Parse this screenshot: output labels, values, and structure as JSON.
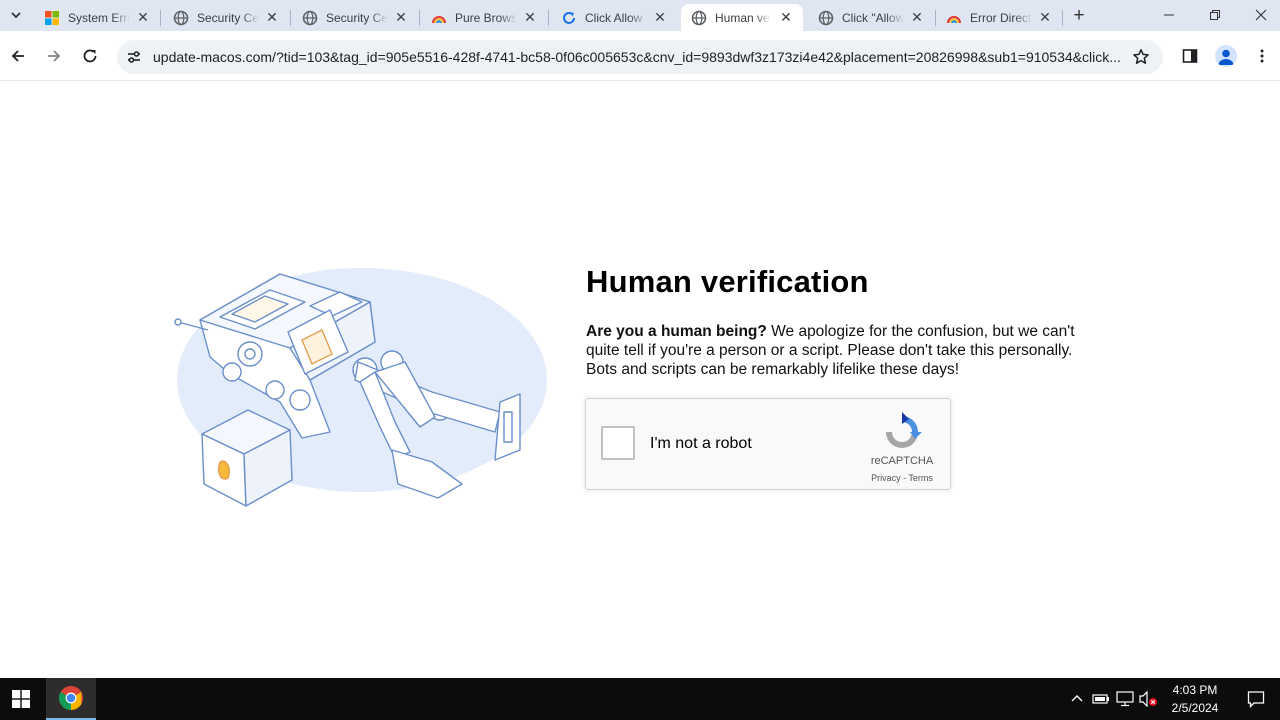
{
  "browser": {
    "tabs": [
      {
        "title": "System Error",
        "icon": "microsoft-icon",
        "active": false
      },
      {
        "title": "Security Center",
        "icon": "globe-icon",
        "active": false
      },
      {
        "title": "Security Center",
        "icon": "globe-icon",
        "active": false
      },
      {
        "title": "Pure Browsing",
        "icon": "rainbow-icon",
        "active": false
      },
      {
        "title": "Click Allow",
        "icon": "refresh-icon",
        "active": false
      },
      {
        "title": "Human verification",
        "icon": "globe-icon",
        "active": true
      },
      {
        "title": "Click \"Allow\"",
        "icon": "globe-icon",
        "active": false
      },
      {
        "title": "Error Directory",
        "icon": "rainbow-icon",
        "active": false
      }
    ],
    "new_tab_label": "+",
    "url": "update-macos.com/?tid=103&tag_id=905e5516-428f-4741-bc58-0f06c005653c&cnv_id=9893dwf3z173zi4e42&placement=20826998&sub1=910534&click..."
  },
  "page": {
    "title": "Human verification",
    "question": "Are you a human being?",
    "body": " We apologize for the confusion, but we can't quite tell if you're a person or a script. Please don't take this personally. Bots and scripts can be remarkably lifelike these days!",
    "captcha": {
      "label": "I'm not a robot",
      "brand": "reCAPTCHA",
      "links": "Privacy - Terms",
      "checked": false
    }
  },
  "taskbar": {
    "time": "4:03 PM",
    "date": "2/5/2024"
  },
  "colors": {
    "tabstrip": "#dfe6f2",
    "omnibox": "#eef1f6",
    "illustration_blob": "#e3ecfa",
    "illustration_line": "#6b8fc9",
    "recaptcha_blue": "#1c3aa9",
    "recaptcha_gray": "#a6a6a6",
    "taskbar": "#0c0c0c"
  }
}
